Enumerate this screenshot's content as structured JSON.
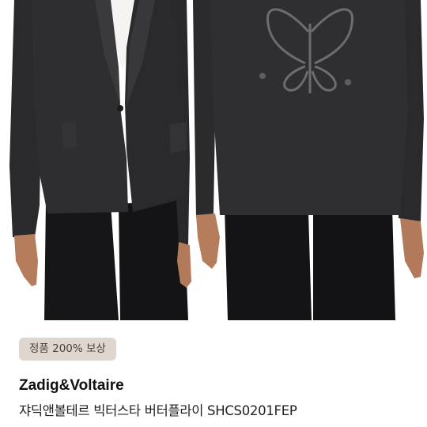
{
  "gallery": {
    "images": [
      {
        "view": "front"
      },
      {
        "view": "back"
      }
    ]
  },
  "product": {
    "badge": "정품 200% 보상",
    "brand": "Zadig&Voltaire",
    "name": "쟈딕앤볼테르 빅터스타 버터플라이 SHCS0201FEP"
  },
  "colors": {
    "badge_bg": "#ded6cf",
    "badge_text": "#4b413b",
    "jacket": "#2b2b2d",
    "skin": "#b57d5c"
  }
}
